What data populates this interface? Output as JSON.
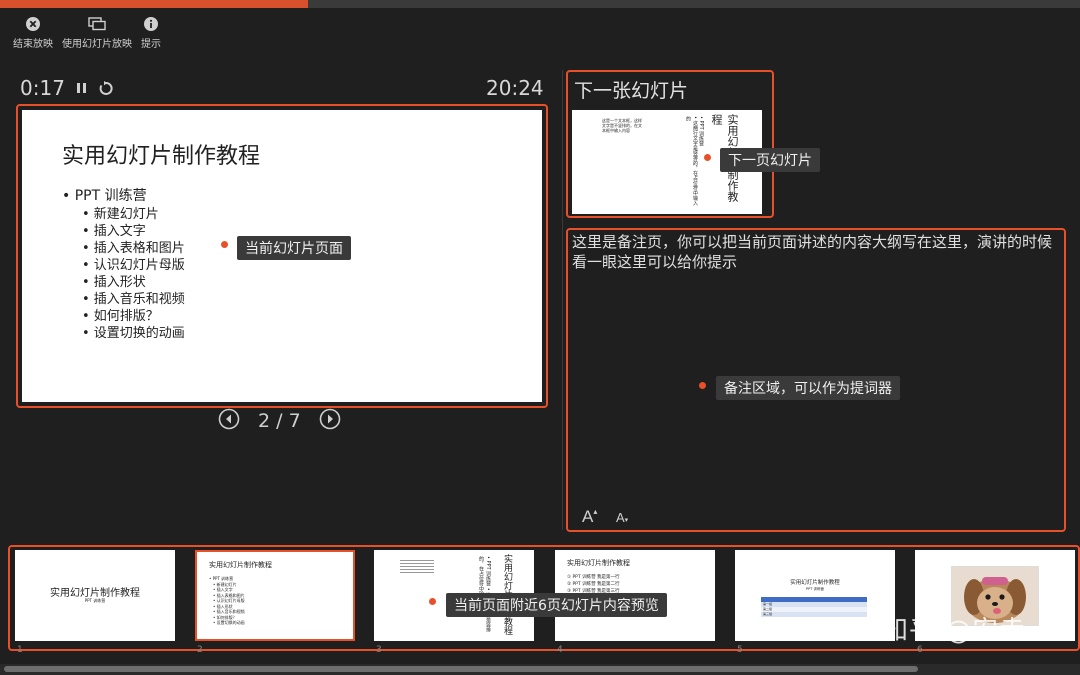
{
  "progress": {
    "fraction": 0.285
  },
  "toolbar": {
    "end_show": "结束放映",
    "use_slideshow": "使用幻灯片放映",
    "tips": "提示"
  },
  "timer": {
    "elapsed": "0:17",
    "clock": "20:24"
  },
  "current_slide": {
    "title": "实用幻灯片制作教程",
    "bullet_main": "• PPT 训练营",
    "bullets": [
      "• 新建幻灯片",
      "• 插入文字",
      "• 插入表格和图片",
      "• 认识幻灯片母版",
      "• 插入形状",
      "• 插入音乐和视频",
      "• 如何排版？",
      "• 设置切换的动画"
    ]
  },
  "navigation": {
    "counter": "2 / 7"
  },
  "next_slide": {
    "heading": "下一张幻灯片",
    "vertical_title": "实用幻灯片制作教程",
    "vertical_line1": "• PPT 训练营",
    "vertical_line2": "• 这两行文字是竖排的，在占位符中输入的",
    "small_text": "这是一个文本框，这样文字是不竖排的，在文本框中输入内容"
  },
  "notes": {
    "text": "这里是备注页，你可以把当前页面讲述的内容大纲写在这里，演讲的时候看一眼这里可以给你提示",
    "font_increase": "A",
    "font_decrease": "A"
  },
  "callouts": {
    "current": "当前幻灯片页面",
    "next": "下一页幻灯片",
    "notes": "备注区域，可以作为提词器",
    "thumbs": "当前页面附近6页幻灯片内容预览"
  },
  "thumbnails": [
    {
      "num": "1",
      "title": "实用幻灯片制作教程",
      "sub": "PPT 训练营"
    },
    {
      "num": "2",
      "title": "实用幻灯片制作教程",
      "lines": [
        "• PPT 训练营",
        "• 新建幻灯片",
        "• 插入文字",
        "• 插入表格和图片",
        "• 认识幻灯片母版",
        "• 插入形状",
        "• 插入音乐和视频",
        "• 如何排版？",
        "• 设置切换的动画"
      ]
    },
    {
      "num": "3",
      "vertical_title": "实用幻灯片制作教程",
      "vertical_line": "• PPT 训练营 • 这两行文字是竖排的，在占位符中输入"
    },
    {
      "num": "4",
      "title": "实用幻灯片制作教程",
      "lines": [
        "① PPT 训练营  我是第一行",
        "② PPT 训练营  我是第二行",
        "③ PPT 训练营  我是第三行"
      ]
    },
    {
      "num": "5",
      "title": "实用幻灯片制作教程",
      "sub": "PPT 训练营",
      "rows": [
        "第一组",
        "第二组",
        "第三组"
      ]
    },
    {
      "num": "6"
    }
  ],
  "watermark": "知乎 @安垚",
  "colors": {
    "accent": "#e8502a",
    "background": "#1f1f1f"
  }
}
